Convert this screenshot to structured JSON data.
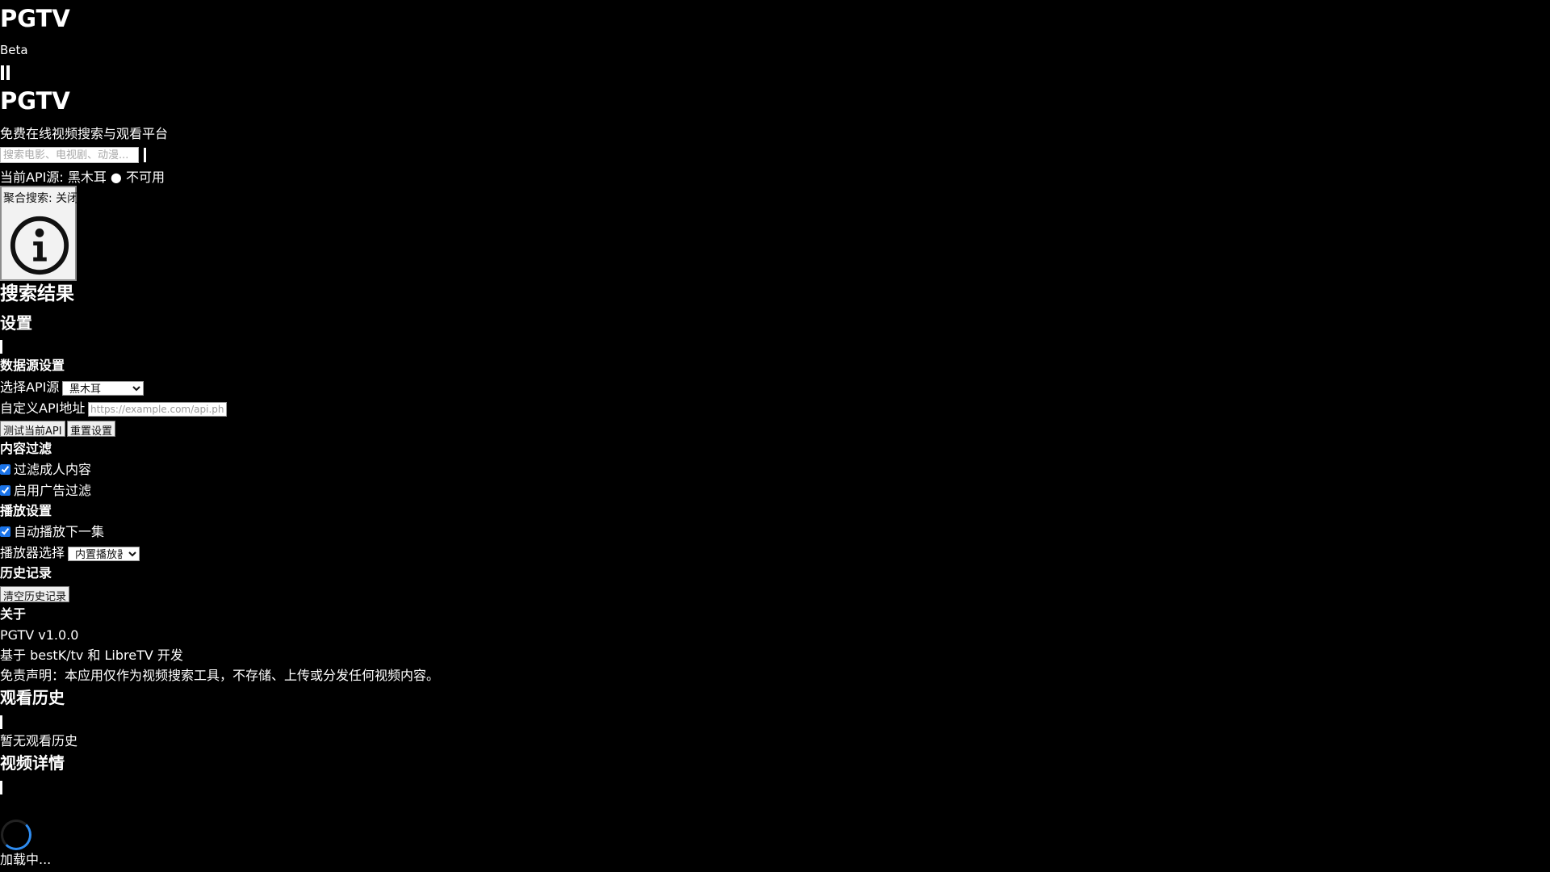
{
  "header": {
    "logo": "PGTV",
    "beta": "Beta"
  },
  "hero": {
    "title": "PGTV",
    "subtitle": "免费在线视频搜索与观看平台"
  },
  "search": {
    "placeholder": "搜索电影、电视剧、动漫..."
  },
  "status": {
    "label": "当前API源:",
    "source": "黑木耳",
    "dot": "●",
    "state": "不可用"
  },
  "aggregate": {
    "label": "聚合搜索: 关闭",
    "icon": "info-icon"
  },
  "results": {
    "title": "搜索结果"
  },
  "settings": {
    "title": "设置",
    "data_source": {
      "title": "数据源设置",
      "api_label": "选择API源",
      "api_selected": "黑木耳",
      "custom_label": "自定义API地址",
      "custom_placeholder": "https://example.com/api.php/",
      "test_button": "测试当前API",
      "reset_button": "重置设置"
    },
    "filter": {
      "title": "内容过滤",
      "adult": "过滤成人内容",
      "ads": "启用广告过滤"
    },
    "playback": {
      "title": "播放设置",
      "autoplay": "自动播放下一集",
      "player_label": "播放器选择",
      "player_selected": "内置播放器"
    },
    "history": {
      "title": "历史记录",
      "clear_button": "清空历史记录"
    },
    "about": {
      "title": "关于",
      "version": "PGTV v1.0.0",
      "credits": "基于 bestK/tv 和 LibreTV 开发",
      "disclaimer": "免责声明：本应用仅作为视频搜索工具，不存储、上传或分发任何视频内容。"
    }
  },
  "watch_history": {
    "title": "观看历史",
    "empty": "暂无观看历史"
  },
  "video_detail": {
    "title": "视频详情",
    "loading": "加载中..."
  },
  "colors": {
    "background": "#000000",
    "text": "#ffffff",
    "spinner_accent": "#2f8cf0"
  }
}
